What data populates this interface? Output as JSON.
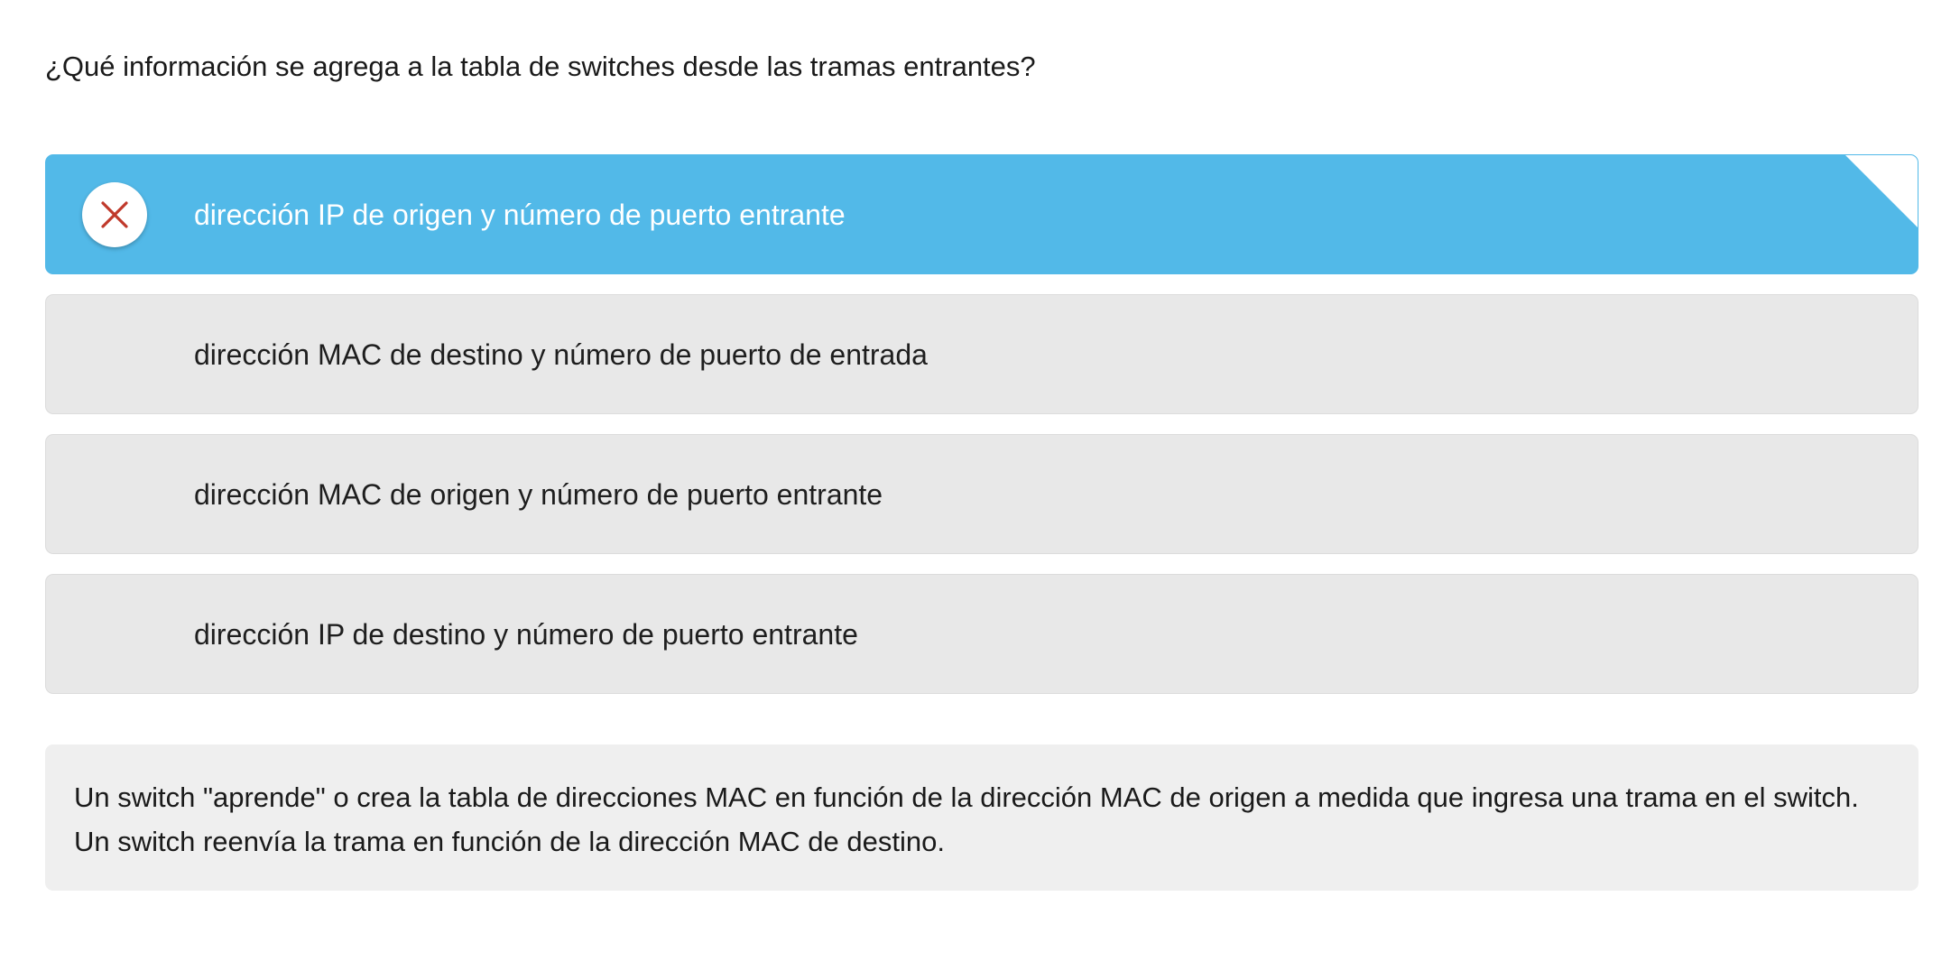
{
  "question": {
    "text": "¿Qué información se agrega a la tabla de switches desde las tramas entrantes?"
  },
  "options": [
    {
      "label": "dirección IP de origen y número de puerto entrante",
      "selected": true,
      "result_icon": "close-icon",
      "result": "incorrect"
    },
    {
      "label": "dirección MAC de destino y número de puerto de entrada",
      "selected": false
    },
    {
      "label": "dirección MAC de origen y número de puerto entrante",
      "selected": false
    },
    {
      "label": "dirección IP de destino y número de puerto entrante",
      "selected": false
    }
  ],
  "feedback": {
    "text": "Un switch \"aprende\" o crea la tabla de direcciones MAC en función de la dirección MAC de origen a medida que ingresa una trama en el switch. Un switch reenvía la trama en función de la dirección MAC de destino."
  },
  "colors": {
    "selected_bg": "#52b9e8",
    "option_bg": "#e8e8e8",
    "incorrect_mark": "#c0392b",
    "feedback_bg": "#efefef"
  }
}
